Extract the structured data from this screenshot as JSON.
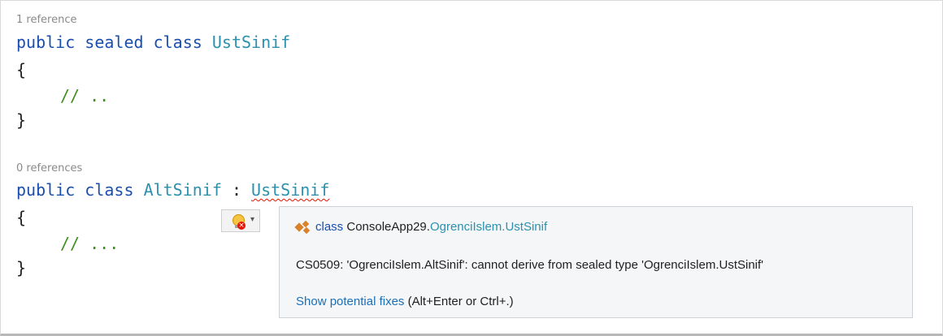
{
  "code": {
    "block1": {
      "references": "1 reference",
      "decl": {
        "kw1": "public",
        "kw2": "sealed",
        "kw3": "class",
        "name": "UstSinif"
      },
      "open_brace": "{",
      "comment": "// ..",
      "close_brace": "}"
    },
    "block2": {
      "references": "0 references",
      "decl": {
        "kw1": "public",
        "kw2": "class",
        "name": "AltSinif",
        "colon": ":",
        "base": "UstSinif"
      },
      "open_brace": "{",
      "comment": "// ...",
      "close_brace": "}"
    }
  },
  "quick_actions": {
    "icon": "lightbulb-error-icon",
    "caret": "▾"
  },
  "tooltip": {
    "class_icon": "class-icon",
    "signature": {
      "kw": "class",
      "ns": "ConsoleApp29.",
      "ns2": "OgrenciIslem.",
      "type": "UstSinif"
    },
    "error": "CS0509: 'OgrenciIslem.AltSinif': cannot derive from sealed type 'OgrenciIslem.UstSinif'",
    "fixes_link": "Show potential fixes",
    "fixes_shortcut": " (Alt+Enter or Ctrl+.)"
  },
  "colors": {
    "keyword": "#1a4fb0",
    "type": "#2b91af",
    "comment": "#3f8f1f",
    "error": "#e51400"
  }
}
